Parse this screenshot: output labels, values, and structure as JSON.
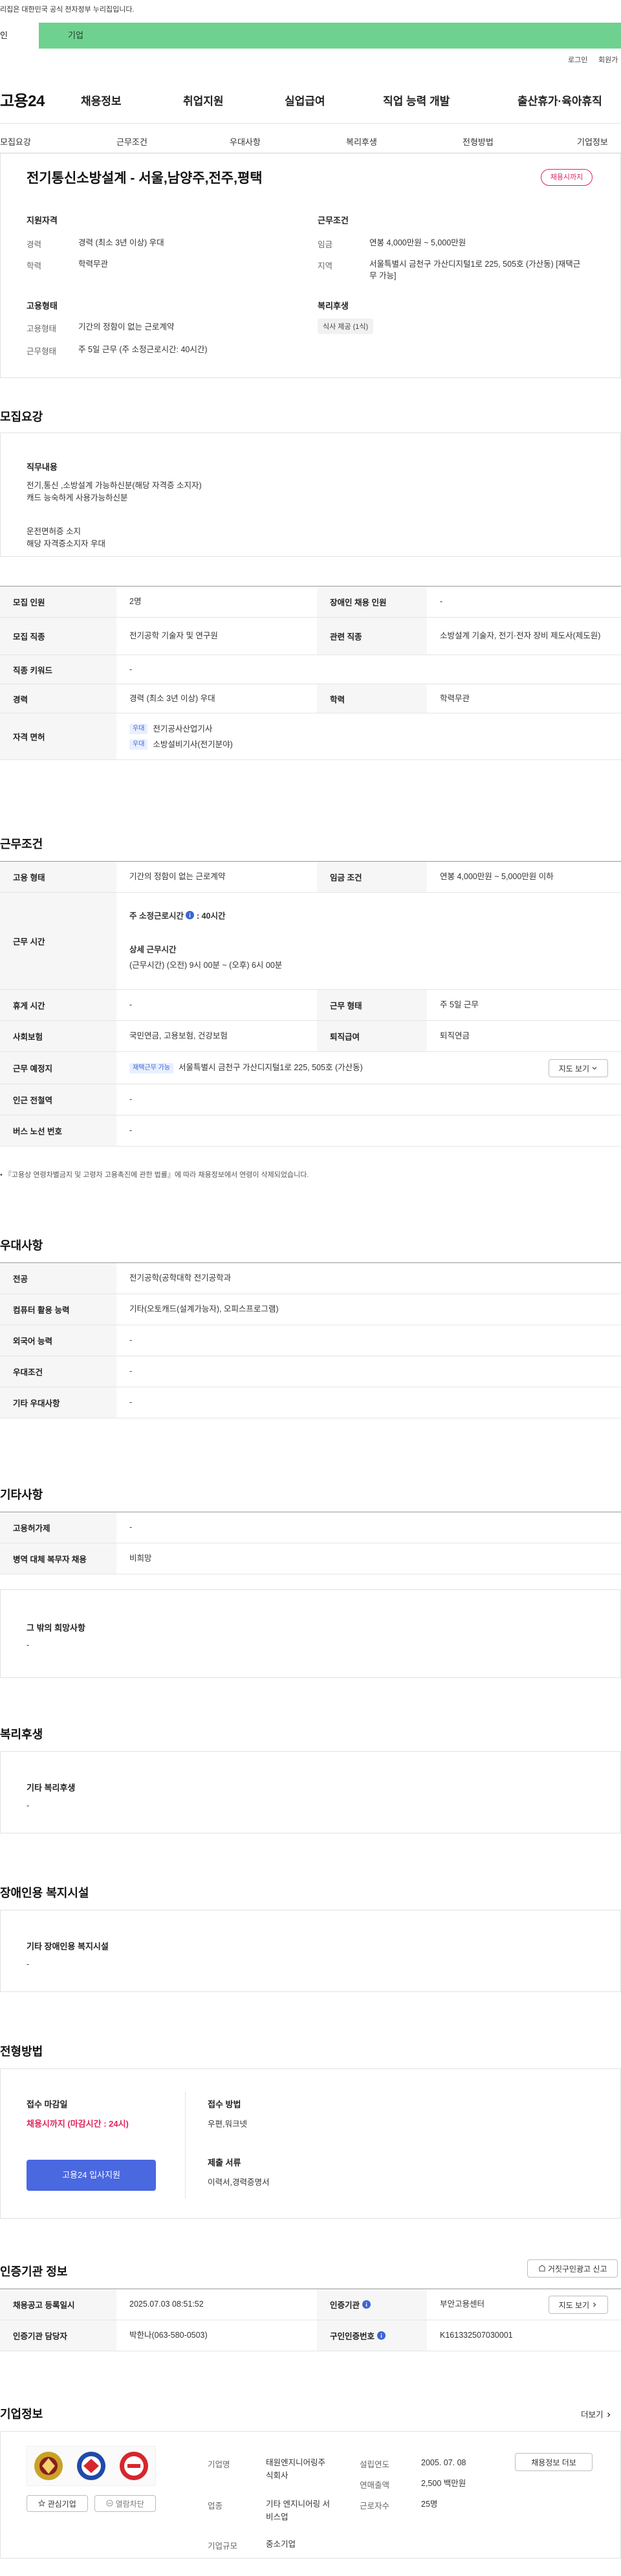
{
  "theme": {
    "brand_green": "#6fd18f",
    "accent_blue": "#4a68e0",
    "deadline_red": "#e0245e"
  },
  "gov_banner": {
    "text": "리집은 대한민국 공식 전자정부 누리집입니다."
  },
  "site_tabs": {
    "person": "인",
    "company": "기업"
  },
  "utility": {
    "login": "로그인",
    "signup": "회원가"
  },
  "header": {
    "logo": "고용24",
    "menu": [
      "채용정보",
      "취업지원",
      "실업급여",
      "직업 능력 개발",
      "출산휴가·육아휴직"
    ]
  },
  "sub_tabs": [
    "모집요강",
    "근무조건",
    "우대사항",
    "복리후생",
    "전형방법",
    "기업정보"
  ],
  "summary": {
    "title": "전기통신소방설계 - 서울,남양주,전주,평택",
    "deadline_badge": "채용시까지",
    "qualification": {
      "heading": "지원자격",
      "rows": [
        {
          "label": "경력",
          "value": "경력 (최소 3년 이상) 우대"
        },
        {
          "label": "학력",
          "value": "학력무관"
        }
      ]
    },
    "employment": {
      "heading": "고용형태",
      "rows": [
        {
          "label": "고용형태",
          "value": "기간의 정함이 없는 근로계약"
        },
        {
          "label": "근무형태",
          "value": "주 5일 근무 (주 소정근로시간: 40시간)"
        }
      ]
    },
    "conditions": {
      "heading": "근무조건",
      "rows": [
        {
          "label": "임금",
          "value": "연봉 4,000만원 ~ 5,000만원"
        },
        {
          "label": "지역",
          "value": "서울특별시 금천구 가산디지털1로 225, 505호 (가산동) [재택근무 가능]"
        }
      ]
    },
    "welfare": {
      "heading": "복리후생",
      "chips": [
        "식사 제공 (1식)"
      ]
    }
  },
  "recruit": {
    "heading": "모집요강",
    "duty": {
      "label": "직무내용",
      "lines_a": [
        "전기,통신 ,소방설계 가능하신분(해당 자격증 소지자)",
        "캐드 능숙하게 사용가능하신분"
      ],
      "lines_b": [
        "운전면허증 소지",
        "해당 자격증소지자 우대"
      ]
    },
    "table": {
      "headcount": {
        "label": "모집 인원",
        "value": "2명"
      },
      "disabled_hire": {
        "label": "장애인 채용 인원",
        "value": "-"
      },
      "job_type": {
        "label": "모집 직종",
        "value": "전기공학 기술자 및 연구원"
      },
      "related_job": {
        "label": "관련 직종",
        "value": "소방설계 기술자, 전기·전자 장비 제도사(제도원)"
      },
      "keyword": {
        "label": "직종 키워드",
        "value": "-"
      },
      "career": {
        "label": "경력",
        "value": "경력 (최소 3년 이상) 우대"
      },
      "education": {
        "label": "학력",
        "value": "학력무관"
      },
      "license": {
        "label": "자격 면허",
        "items": [
          {
            "tag": "우대",
            "name": "전기공사산업기사"
          },
          {
            "tag": "우대",
            "name": "소방설비기사(전기분야)"
          }
        ]
      }
    }
  },
  "work": {
    "heading": "근무조건",
    "employment_type": {
      "label": "고용 형태",
      "value": "기간의 정함이 없는 근로계약"
    },
    "wage": {
      "label": "임금 조건",
      "value": "연봉 4,000만원 ~ 5,000만원 이하"
    },
    "hours": {
      "label": "근무 시간",
      "weekly_label": "주 소정근로시간",
      "weekly_value": ": 40시간",
      "detail_label": "상세 근무시간",
      "detail_value": "(근무시간) (오전) 9시 00분 ~ (오후) 6시 00분"
    },
    "break_time": {
      "label": "휴게 시간",
      "value": "-"
    },
    "work_form": {
      "label": "근무 형태",
      "value": "주 5일 근무"
    },
    "insurance": {
      "label": "사회보험",
      "value": "국민연금, 고용보험, 건강보험"
    },
    "retirement": {
      "label": "퇴직급여",
      "value": "퇴직연금"
    },
    "location": {
      "label": "근무 예정지",
      "tag": "재택근무 가능",
      "value": "서울특별시 금천구 가산디지털1로 225, 505호 (가산동)",
      "map_button": "지도 보기"
    },
    "subway": {
      "label": "인근 전철역",
      "value": "-"
    },
    "bus": {
      "label": "버스 노선 번호",
      "value": "-"
    },
    "note": "• 『고용상 연령차별금지 및 고령자 고용촉진에 관한 법률』에 따라 채용정보에서 연령이 삭제되었습니다."
  },
  "preference": {
    "heading": "우대사항",
    "rows": [
      {
        "label": "전공",
        "value": "전기공학(공학대학 전기공학과"
      },
      {
        "label": "컴퓨터 활용 능력",
        "value": "기타(오토캐드(설계가능자), 오피스프로그램)"
      },
      {
        "label": "외국어 능력",
        "value": "-"
      },
      {
        "label": "우대조건",
        "value": "-"
      },
      {
        "label": "기타 우대사항",
        "value": "-"
      }
    ]
  },
  "etc": {
    "heading": "기타사항",
    "rows": [
      {
        "label": "고용허가제",
        "value": "-"
      },
      {
        "label": "병역 대체 복무자 채용",
        "value": "비희망"
      }
    ],
    "other": {
      "label": "그 밖의 희망사항",
      "value": "-"
    }
  },
  "welfare": {
    "heading": "복리후생",
    "label": "기타 복리후생",
    "value": "-"
  },
  "disability": {
    "heading": "장애인용 복지시설",
    "label": "기타 장애인용 복지시설",
    "value": "-"
  },
  "selection": {
    "heading": "전형방법",
    "deadline_label": "접수 마감일",
    "deadline_value": "채용시까지 (마감시간 : 24시)",
    "apply_button": "고용24 입사지원",
    "method_label": "접수 방법",
    "method_value": "우편,워크넷",
    "docs_label": "제출 서류",
    "docs_value": "이력서,경력증명서"
  },
  "certification": {
    "heading": "인증기관 정보",
    "report_button": "거짓구인광고 신고",
    "reg_date": {
      "label": "채용공고 등록일시",
      "value": "2025.07.03 08:51:52"
    },
    "agency": {
      "label": "인증기관",
      "value": "부안고용센터",
      "map_button": "지도 보기"
    },
    "manager": {
      "label": "인증기관 담당자",
      "value": "박한나(063-580-0503)"
    },
    "cert_no": {
      "label": "구인인증번호",
      "value": "K161332507030001"
    }
  },
  "company": {
    "heading": "기업정보",
    "more": "더보기",
    "fav_button": "관심기업",
    "block_button": "열람차단",
    "jobs_button": "채용정보 더보",
    "name": {
      "label": "기업명",
      "value": "태원엔지니어링주식회사"
    },
    "industry": {
      "label": "업종",
      "value": "기타 엔지니어링 서비스업"
    },
    "size": {
      "label": "기업규모",
      "value": "중소기업"
    },
    "founded": {
      "label": "설립연도",
      "value": "2005. 07. 08"
    },
    "revenue": {
      "label": "연매출액",
      "value": "2,500 백만원"
    },
    "employees": {
      "label": "근로자수",
      "value": "25명"
    }
  }
}
